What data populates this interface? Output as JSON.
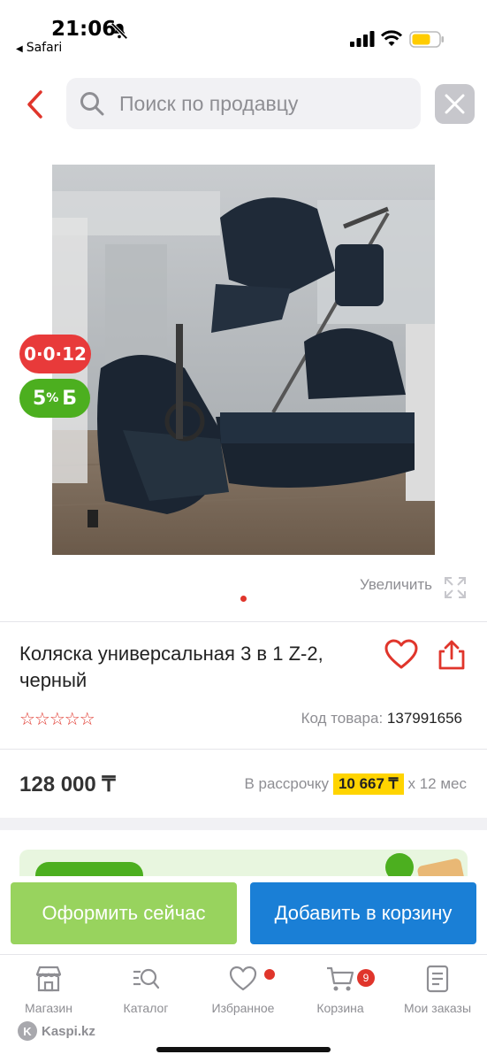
{
  "status_bar": {
    "time": "21:06",
    "back_app": "Safari"
  },
  "search": {
    "placeholder": "Поиск по продавцу"
  },
  "product": {
    "badge_installment": "0·0·12",
    "badge_bonus_value": "5",
    "badge_bonus_pct": "%",
    "badge_bonus_currency": "Б",
    "enlarge_label": "Увеличить",
    "title": "Коляска универсальная 3 в 1 Z-2, черный",
    "stars": "☆☆☆☆☆",
    "rating_value": 0,
    "sku_label": "Код товара:",
    "sku_value": "137991656",
    "price": "128 000 ₸",
    "installment_prefix": "В рассрочку",
    "installment_amount": "10 667 ₸",
    "installment_suffix": "х 12 мес"
  },
  "actions": {
    "checkout_label": "Оформить сейчас",
    "add_to_cart_label": "Добавить в корзину"
  },
  "tabbar": {
    "items": [
      {
        "label": "Магазин",
        "icon": "shop-icon"
      },
      {
        "label": "Каталог",
        "icon": "catalog-search-icon"
      },
      {
        "label": "Избранное",
        "icon": "heart-icon"
      },
      {
        "label": "Корзина",
        "icon": "cart-icon",
        "badge": "9"
      },
      {
        "label": "Мои заказы",
        "icon": "orders-icon"
      }
    ]
  },
  "watermark": {
    "text": "Kaspi.kz"
  },
  "colors": {
    "accent_red": "#e0352b",
    "checkout_green": "#98d35e",
    "cart_blue": "#1a7fd6",
    "bonus_green": "#4caf1f",
    "installment_yellow": "#ffd400"
  }
}
